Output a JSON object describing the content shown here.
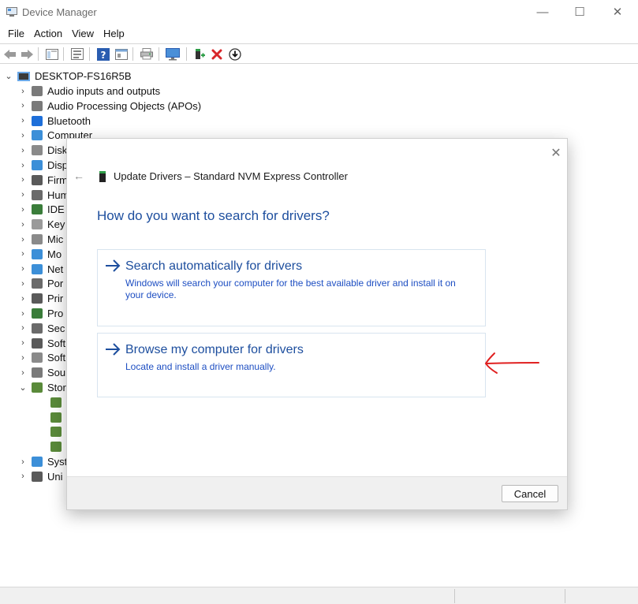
{
  "window": {
    "title": "Device Manager",
    "controls": {
      "minimize": "—",
      "maximize": "☐",
      "close": "✕"
    }
  },
  "menu": [
    "File",
    "Action",
    "View",
    "Help"
  ],
  "toolbar": {
    "buttons": [
      "back-icon",
      "forward-icon",
      "show-hide-icon",
      "properties-icon",
      "help-icon",
      "view-icon",
      "print-icon",
      "monitor-icon",
      "add-driver-icon",
      "uninstall-icon",
      "update-driver-icon"
    ],
    "colors": {
      "uninstall": "#d8262a",
      "add": "#2e9e48"
    }
  },
  "tree": {
    "root": "DESKTOP-FS16R5B",
    "items": [
      {
        "label": "Audio inputs and outputs",
        "icon": "speaker-icon",
        "color": "#7a7a7a"
      },
      {
        "label": "Audio Processing Objects (APOs)",
        "icon": "speaker-icon",
        "color": "#7a7a7a"
      },
      {
        "label": "Bluetooth",
        "icon": "bluetooth-icon",
        "color": "#1e6fd9"
      },
      {
        "label": "Computer",
        "icon": "computer-icon",
        "color": "#3c8fd8"
      },
      {
        "label": "Disk",
        "icon": "disk-icon",
        "color": "#8a8a8a"
      },
      {
        "label": "Disp",
        "icon": "display-icon",
        "color": "#3c8fd8"
      },
      {
        "label": "Firm",
        "icon": "firmware-icon",
        "color": "#5a5a5a"
      },
      {
        "label": "Hum",
        "icon": "hid-icon",
        "color": "#6a6a6a"
      },
      {
        "label": "IDE",
        "icon": "ide-icon",
        "color": "#3a7d3a"
      },
      {
        "label": "Key",
        "icon": "keyboard-icon",
        "color": "#9a9a9a"
      },
      {
        "label": "Mic",
        "icon": "mouse-icon",
        "color": "#8a8a8a"
      },
      {
        "label": "Mo",
        "icon": "monitor-icon",
        "color": "#3c8fd8"
      },
      {
        "label": "Net",
        "icon": "network-icon",
        "color": "#3c8fd8"
      },
      {
        "label": "Por",
        "icon": "port-icon",
        "color": "#6a6a6a"
      },
      {
        "label": "Prir",
        "icon": "printer-icon",
        "color": "#5a5a5a"
      },
      {
        "label": "Pro",
        "icon": "processor-icon",
        "color": "#3a7d3a"
      },
      {
        "label": "Sec",
        "icon": "security-icon",
        "color": "#6a6a6a"
      },
      {
        "label": "Soft",
        "icon": "software-component-icon",
        "color": "#5a5a5a"
      },
      {
        "label": "Soft",
        "icon": "software-device-icon",
        "color": "#8a8a8a"
      },
      {
        "label": "Sou",
        "icon": "sound-icon",
        "color": "#7a7a7a"
      },
      {
        "label": "Stor",
        "icon": "storage-icon",
        "color": "#5a8a3a"
      }
    ],
    "children": [
      {
        "icon": "storage-controller-icon"
      },
      {
        "icon": "storage-controller-icon"
      },
      {
        "icon": "storage-controller-icon"
      },
      {
        "icon": "storage-controller-icon"
      }
    ],
    "after": [
      {
        "label": "Syst",
        "icon": "system-icon",
        "color": "#3c8fd8"
      },
      {
        "label": "Uni",
        "icon": "usb-icon",
        "color": "#5a5a5a"
      }
    ]
  },
  "dialog": {
    "header": "Update Drivers – Standard NVM Express Controller",
    "question": "How do you want to search for drivers?",
    "options": [
      {
        "title": "Search automatically for drivers",
        "description": "Windows will search your computer for the best available driver and install it on your device."
      },
      {
        "title": "Browse my computer for drivers",
        "description": "Locate and install a driver manually."
      }
    ],
    "cancel_label": "Cancel",
    "close_glyph": "✕",
    "back_glyph": "←"
  },
  "theme": {
    "accent_blue": "#1d4e9e",
    "link_blue": "#1d4ec2",
    "annotation_red": "#e02020"
  }
}
